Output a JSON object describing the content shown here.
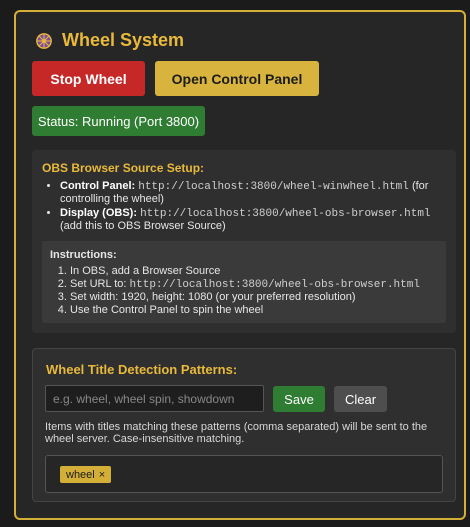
{
  "header": {
    "title": "Wheel System",
    "icon": "wheel-icon"
  },
  "controls": {
    "stop_label": "Stop Wheel",
    "open_label": "Open Control Panel"
  },
  "status": {
    "text": "Status: Running (Port 3800)"
  },
  "obs": {
    "title": "OBS Browser Source Setup:",
    "items": [
      {
        "label": "Control Panel:",
        "url": "http://localhost:3800/wheel-winwheel.html",
        "note": "(for controlling the wheel)"
      },
      {
        "label": "Display (OBS):",
        "url": "http://localhost:3800/wheel-obs-browser.html",
        "note": "(add this to OBS Browser Source)"
      }
    ],
    "instructions": {
      "title": "Instructions:",
      "steps": [
        "In OBS, add a Browser Source",
        "Set URL to:",
        "Set width: 1920, height: 1080 (or your preferred resolution)",
        "Use the Control Panel to spin the wheel"
      ],
      "step2_url": "http://localhost:3800/wheel-obs-browser.html"
    }
  },
  "patterns": {
    "title": "Wheel Title Detection Patterns:",
    "input_value": "",
    "input_placeholder": "e.g. wheel, wheel spin, showdown",
    "save_label": "Save",
    "clear_label": "Clear",
    "help": "Items with titles matching these patterns (comma separated) will be sent to the wheel server. Case-insensitive matching.",
    "tags": [
      {
        "label": "wheel",
        "remove": "×"
      }
    ]
  },
  "colors": {
    "accent": "#d4af37",
    "stop": "#c62828",
    "running": "#2e7d32"
  }
}
